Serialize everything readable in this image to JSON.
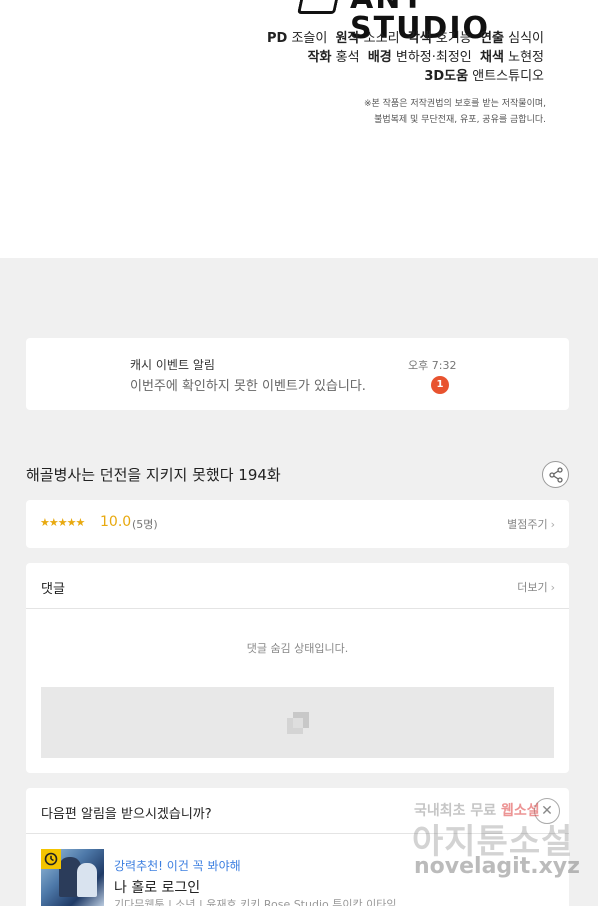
{
  "credits": {
    "studio_name": "ANT STUDIO",
    "lines": [
      [
        {
          "role": "PD",
          "names": "조슬이"
        },
        {
          "role": "원작",
          "names": "소소리"
        },
        {
          "role": "각색",
          "names": "호기능"
        },
        {
          "role": "연출",
          "names": "심식이"
        }
      ],
      [
        {
          "role": "작화",
          "names": "홍석"
        },
        {
          "role": "배경",
          "names": "변하정·최정인"
        },
        {
          "role": "채색",
          "names": "노현정"
        }
      ],
      [
        {
          "role": "3D도움",
          "names": "앤트스튜디오"
        }
      ]
    ],
    "copyright_line1": "※본 작품은 저작권법의 보호를 받는 저작물이며,",
    "copyright_line2": "불법복제 및 무단전재, 유포, 공유를 금합니다."
  },
  "notification": {
    "title": "캐시 이벤트 알림",
    "body": "이번주에 확인하지 못한 이벤트가 있습니다.",
    "time": "오후 7:32",
    "count": "1"
  },
  "episode": {
    "title": "해골병사는 던전을 지키지 못했다 194화",
    "share_icon": "share-icon"
  },
  "rating": {
    "stars": "★★★★★",
    "score": "10.0",
    "votes": "(5명)",
    "rate_label": "별점주기"
  },
  "comments": {
    "title": "댓글",
    "more_label": "더보기",
    "hidden_message": "댓글 숨김 상태입니다."
  },
  "subscribe": {
    "title": "다음편 알림을 받으시겠습니까?",
    "close_symbol": "✕",
    "recommendation": {
      "tag": "강력추천! 이건 꼭 봐야해",
      "title": "나 홀로 로그인",
      "meta": "기다무웹툰 | 소년 | 윤재호,키키,Rose Studio,투이칸,이타임"
    }
  },
  "watermark": {
    "line1_prefix": "국내최초 무료",
    "line1_highlight": "웹소설",
    "line2": "아지툰소설",
    "line3": "novelagit.xyz"
  },
  "colors": {
    "accent_rating": "#e8a90f",
    "badge_red": "#e8532f",
    "link_blue": "#3d7fe0",
    "timer_yellow": "#f3c400"
  }
}
